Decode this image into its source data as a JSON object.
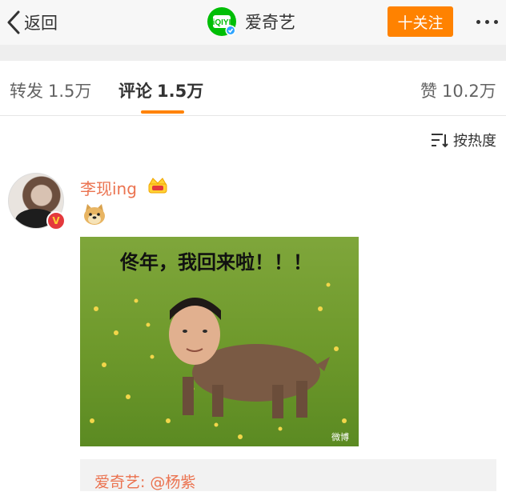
{
  "header": {
    "back_label": "返回",
    "brand_name": "爱奇艺",
    "follow_label": "十关注",
    "accent": "#ff8200",
    "brand_color": "#00be06"
  },
  "tabs": [
    {
      "label": "转发",
      "count": "1.5万",
      "active": false
    },
    {
      "label": "评论",
      "count": "1.5万",
      "active": true
    },
    {
      "label": "赞",
      "count": "10.2万",
      "active": false
    }
  ],
  "sort": {
    "label": "按热度",
    "icon": "sort-icon"
  },
  "comment": {
    "username": "李现ing",
    "name_color": "#eb7350",
    "badges": [
      "crown-icon",
      "verified-badge"
    ],
    "emoji": "doge-emoji",
    "image": {
      "caption": "佟年，我回来啦！！！",
      "watermark": "微博"
    },
    "reply": {
      "author": "爱奇艺:",
      "mention": "@杨紫"
    }
  }
}
